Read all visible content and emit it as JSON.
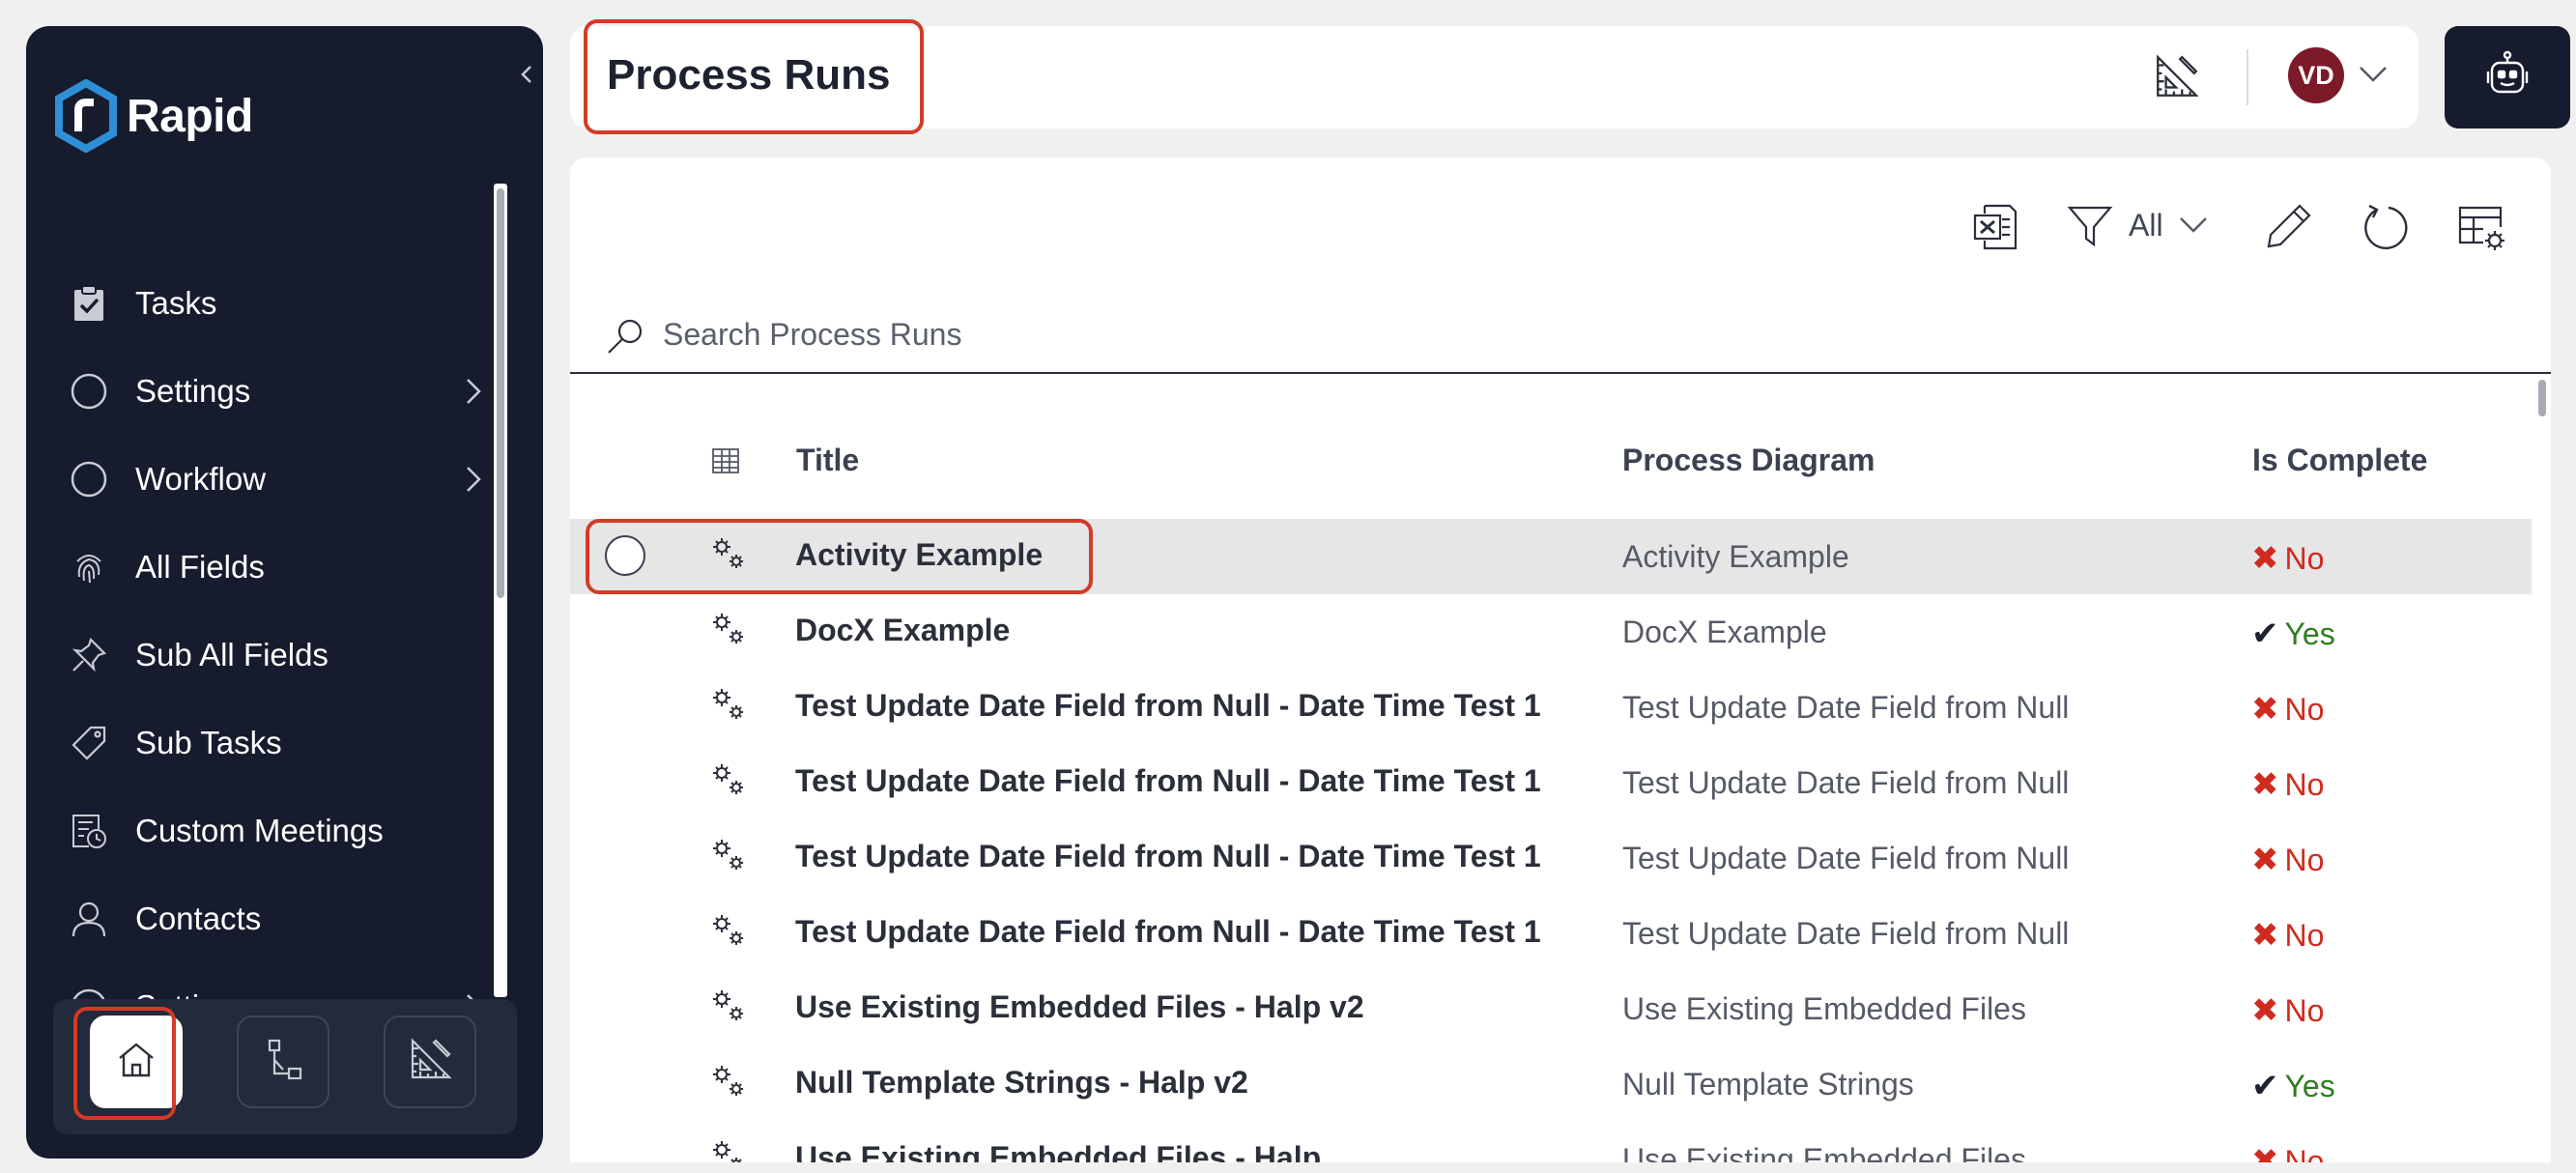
{
  "sidebar": {
    "logo_text": "Rapid",
    "items": [
      {
        "label": "Tasks",
        "icon": "clipboard-check-icon",
        "has_chevron": false
      },
      {
        "label": "Settings",
        "icon": "circle-icon",
        "has_chevron": true
      },
      {
        "label": "Workflow",
        "icon": "circle-icon",
        "has_chevron": true
      },
      {
        "label": "All Fields",
        "icon": "fingerprint-icon",
        "has_chevron": false
      },
      {
        "label": "Sub All Fields",
        "icon": "pin-icon",
        "has_chevron": false
      },
      {
        "label": "Sub Tasks",
        "icon": "tag-icon",
        "has_chevron": false
      },
      {
        "label": "Custom Meetings",
        "icon": "calendar-clock-icon",
        "has_chevron": false
      },
      {
        "label": "Contacts",
        "icon": "person-icon",
        "has_chevron": false
      },
      {
        "label": "Settings",
        "icon": "circle-icon",
        "has_chevron": true
      }
    ],
    "bottom_buttons": [
      "home-icon",
      "workflow-icon",
      "ruler-icon"
    ]
  },
  "header": {
    "title": "Process Runs",
    "avatar_initials": "VD"
  },
  "toolbar": {
    "filter_label": "All"
  },
  "search": {
    "placeholder": "Search Process Runs"
  },
  "table": {
    "columns": [
      "Title",
      "Process Diagram",
      "Is Complete"
    ],
    "rows": [
      {
        "title": "Activity Example",
        "diagram": "Activity Example",
        "complete": "No"
      },
      {
        "title": "DocX Example",
        "diagram": "DocX Example",
        "complete": "Yes"
      },
      {
        "title": "Test Update Date Field from Null - Date Time Test 1",
        "diagram": "Test Update Date Field from Null",
        "complete": "No"
      },
      {
        "title": "Test Update Date Field from Null - Date Time Test 1",
        "diagram": "Test Update Date Field from Null",
        "complete": "No"
      },
      {
        "title": "Test Update Date Field from Null - Date Time Test 1",
        "diagram": "Test Update Date Field from Null",
        "complete": "No"
      },
      {
        "title": "Test Update Date Field from Null - Date Time Test 1",
        "diagram": "Test Update Date Field from Null",
        "complete": "No"
      },
      {
        "title": "Use Existing Embedded Files - Halp v2",
        "diagram": "Use Existing Embedded Files",
        "complete": "No"
      },
      {
        "title": "Null Template Strings - Halp v2",
        "diagram": "Null Template Strings",
        "complete": "Yes"
      },
      {
        "title": "Use Existing Embedded Files - Halp",
        "diagram": "Use Existing Embedded Files",
        "complete": "No"
      }
    ]
  },
  "colors": {
    "sidebar_bg": "#161c2e",
    "highlight": "#d33b26",
    "no": "#d02b1f",
    "yes": "#2e7d1e",
    "avatar": "#7b1a28",
    "logo_blue": "#2f8fd6"
  }
}
